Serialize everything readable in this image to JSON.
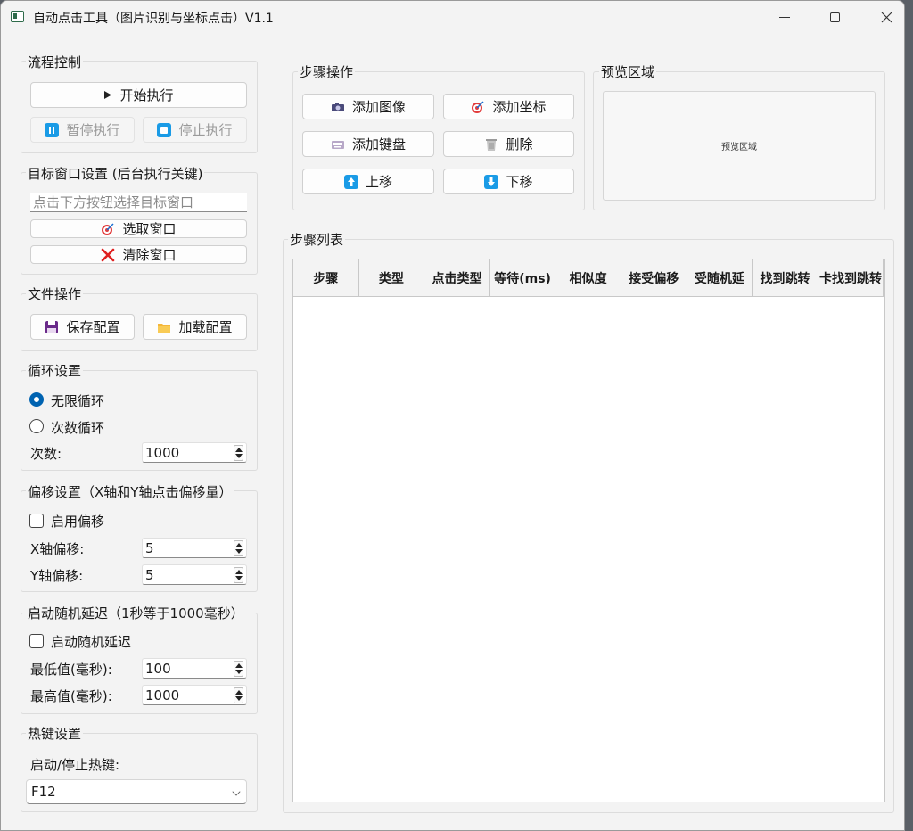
{
  "window": {
    "title": "自动点击工具（图片识别与坐标点击）V1.1"
  },
  "flow": {
    "title": "流程控制",
    "start": "开始执行",
    "pause": "暂停执行",
    "stop": "停止执行"
  },
  "target": {
    "title": "目标窗口设置 (后台执行关键)",
    "placeholder": "点击下方按钮选择目标窗口",
    "select": "选取窗口",
    "clear": "清除窗口"
  },
  "file": {
    "title": "文件操作",
    "save": "保存配置",
    "load": "加载配置"
  },
  "loop": {
    "title": "循环设置",
    "infinite": "无限循环",
    "count_mode": "次数循环",
    "count_label": "次数:",
    "count_value": "1000"
  },
  "offset": {
    "title": "偏移设置（X轴和Y轴点击偏移量）",
    "enable": "启用偏移",
    "x_label": "X轴偏移:",
    "x_value": "5",
    "y_label": "Y轴偏移:",
    "y_value": "5"
  },
  "delay": {
    "title": "启动随机延迟（1秒等于1000毫秒）",
    "enable": "启动随机延迟",
    "min_label": "最低值(毫秒):",
    "min_value": "100",
    "max_label": "最高值(毫秒):",
    "max_value": "1000"
  },
  "hotkey": {
    "title": "热键设置",
    "label": "启动/停止热键:",
    "value": "F12"
  },
  "steps": {
    "title": "步骤操作",
    "add_image": "添加图像",
    "add_coord": "添加坐标",
    "add_keyboard": "添加键盘",
    "delete": "删除",
    "move_up": "上移",
    "move_down": "下移"
  },
  "preview": {
    "title": "预览区域",
    "placeholder": "预览区域"
  },
  "list": {
    "title": "步骤列表",
    "columns": [
      "步骤",
      "类型",
      "点击类型",
      "等待(ms)",
      "相似度",
      "接受偏移",
      "受随机延",
      "找到跳转",
      "卡找到跳转"
    ]
  }
}
